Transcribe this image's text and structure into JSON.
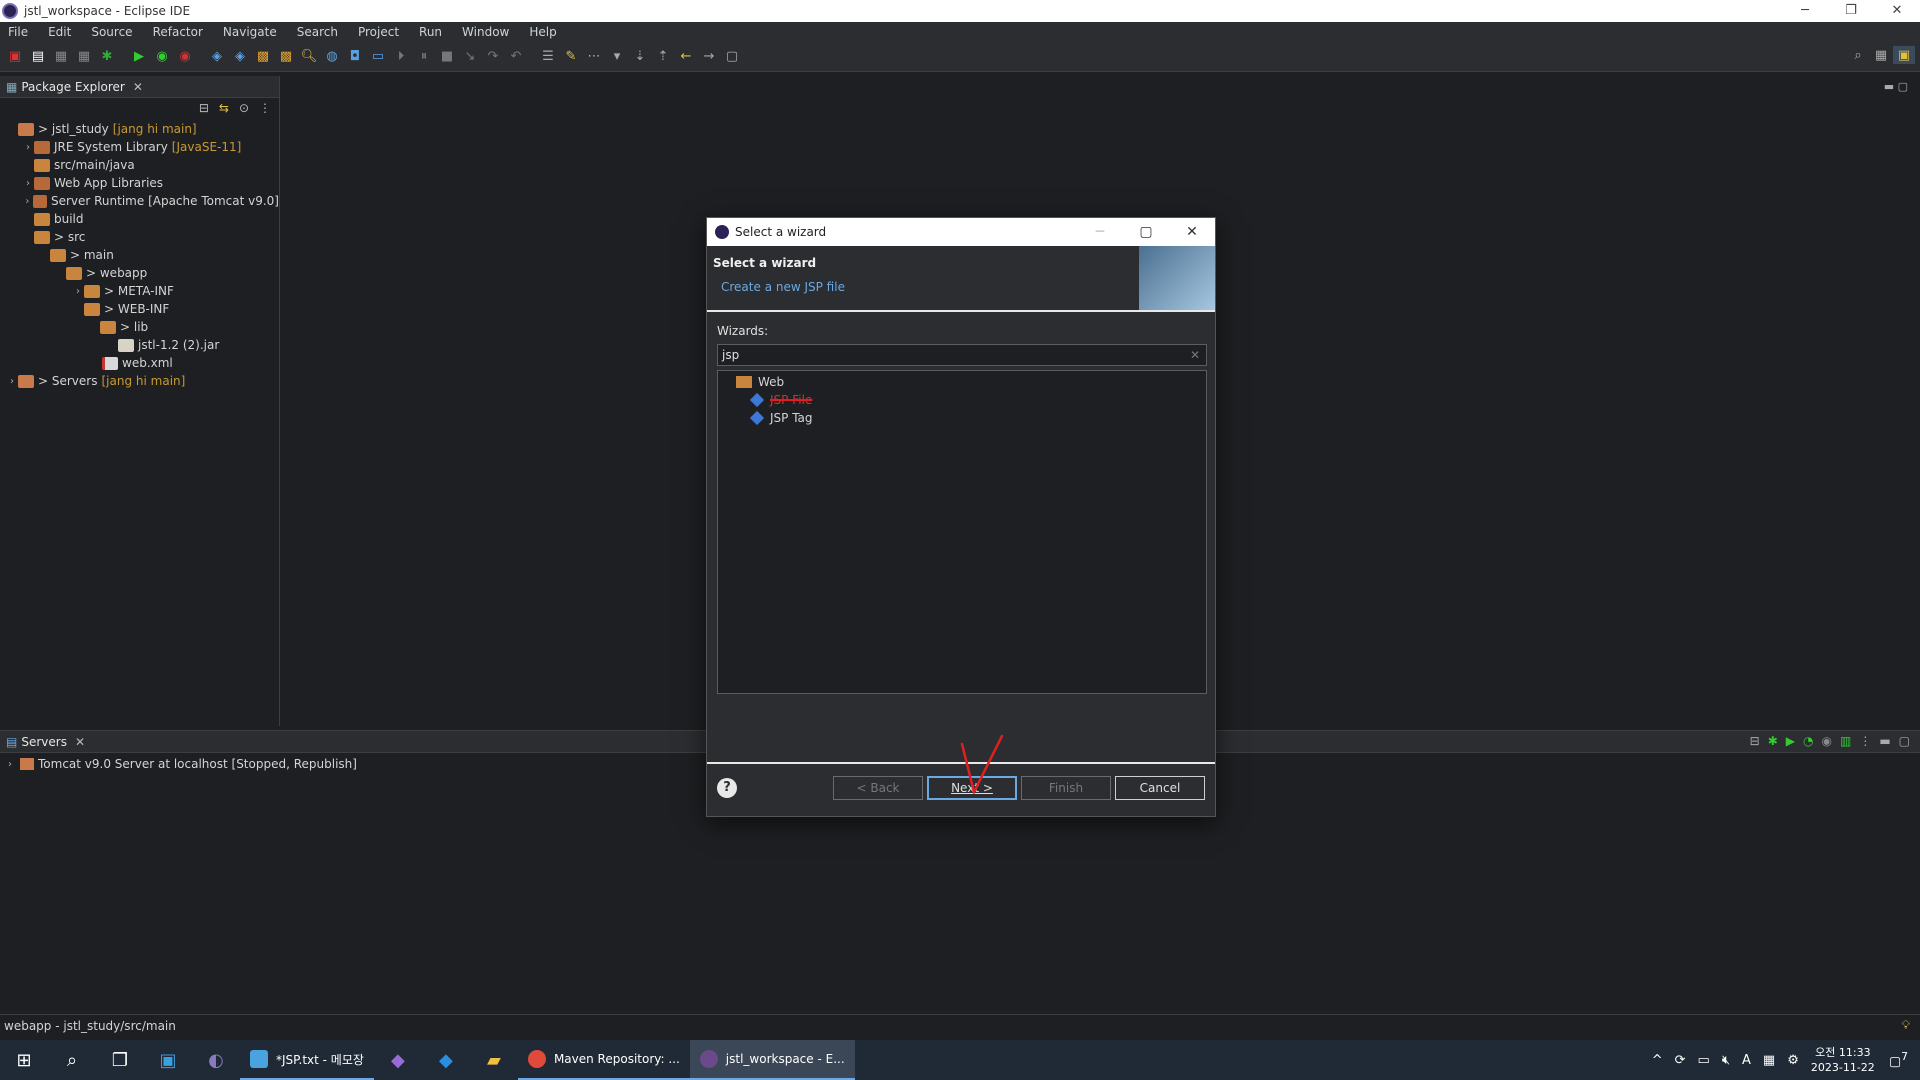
{
  "window": {
    "title": "jstl_workspace - Eclipse IDE",
    "controls": [
      "─",
      "❐",
      "✕"
    ]
  },
  "menu": [
    "File",
    "Edit",
    "Source",
    "Refactor",
    "Navigate",
    "Search",
    "Project",
    "Run",
    "Window",
    "Help"
  ],
  "package_explorer": {
    "tab_label": "Package Explorer",
    "tree": [
      {
        "label": "> jstl_study",
        "decoration": "[jang hi main]"
      },
      {
        "label": "JRE System Library",
        "decoration": "[JavaSE-11]"
      },
      {
        "label": "src/main/java",
        "decoration": ""
      },
      {
        "label": "Web App Libraries",
        "decoration": ""
      },
      {
        "label": "Server Runtime [Apache Tomcat v9.0]",
        "decoration": ""
      },
      {
        "label": "build",
        "decoration": ""
      },
      {
        "label": "> src",
        "decoration": ""
      },
      {
        "label": "> main",
        "decoration": ""
      },
      {
        "label": "> webapp",
        "decoration": ""
      },
      {
        "label": "> META-INF",
        "decoration": ""
      },
      {
        "label": "> WEB-INF",
        "decoration": ""
      },
      {
        "label": "> lib",
        "decoration": ""
      },
      {
        "label": "jstl-1.2 (2).jar",
        "decoration": ""
      },
      {
        "label": "web.xml",
        "decoration": ""
      },
      {
        "label": "> Servers",
        "decoration": "[jang hi main]"
      }
    ]
  },
  "servers_panel": {
    "tab_label": "Servers",
    "rows": [
      "Tomcat v9.0 Server at localhost  [Stopped, Republish]"
    ]
  },
  "status_bar": {
    "text": "webapp - jstl_study/src/main"
  },
  "dialog": {
    "title": "Select a wizard",
    "heading": "Select a wizard",
    "description": "Create a new JSP file",
    "wizards_label": "Wizards:",
    "filter_value": "jsp",
    "tree": [
      {
        "label": "Web",
        "type": "folder"
      },
      {
        "label": "JSP File",
        "type": "item",
        "annotated": true
      },
      {
        "label": "JSP Tag",
        "type": "item"
      }
    ],
    "buttons": {
      "back": "< Back",
      "next": "Next >",
      "finish": "Finish",
      "cancel": "Cancel"
    },
    "annotation_color": "#e02020"
  },
  "taskbar": {
    "apps": [
      {
        "label": "*JSP.txt - 메모장",
        "active": false
      },
      {
        "label": "Maven Repository: ...",
        "active": false
      },
      {
        "label": "jstl_workspace - E...",
        "active": true
      }
    ],
    "clock_time": "오전 11:33",
    "clock_date": "2023-11-22",
    "notification_count": "7"
  }
}
